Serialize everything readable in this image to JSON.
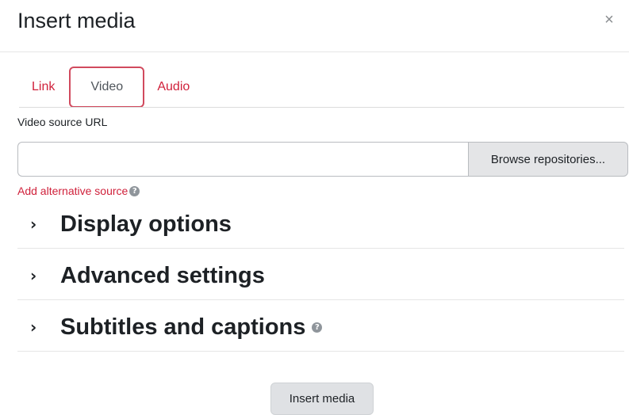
{
  "dialog": {
    "title": "Insert media",
    "close_symbol": "×"
  },
  "tabs": [
    {
      "label": "Link",
      "active": false
    },
    {
      "label": "Video",
      "active": true
    },
    {
      "label": "Audio",
      "active": false
    }
  ],
  "video": {
    "source_label": "Video source URL",
    "source_value": "",
    "browse_label": "Browse repositories...",
    "add_alternative_label": "Add alternative source"
  },
  "sections": [
    {
      "title": "Display options",
      "has_help": false
    },
    {
      "title": "Advanced settings",
      "has_help": false
    },
    {
      "title": "Subtitles and captions",
      "has_help": true
    }
  ],
  "footer": {
    "submit_label": "Insert media"
  },
  "icons": {
    "chevron": "›",
    "help": "?"
  },
  "colors": {
    "link": "#d0213b",
    "active_tab_border": "#d14a5e",
    "button_bg": "#e4e5e7"
  }
}
